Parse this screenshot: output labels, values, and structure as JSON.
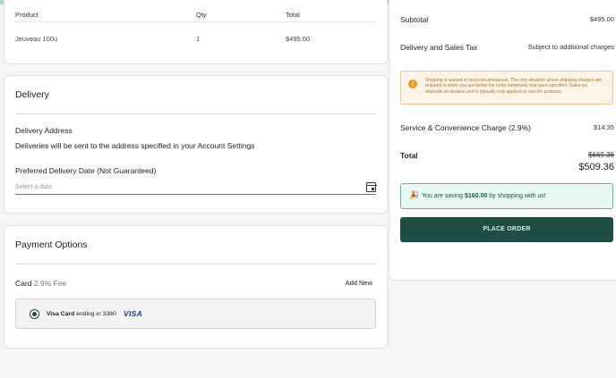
{
  "items": {
    "headers": {
      "product": "Product",
      "qty": "Qty",
      "total": "Total"
    },
    "rows": [
      {
        "product": "Jeuveau 100u",
        "qty": "1",
        "total": "$495.00"
      }
    ]
  },
  "delivery": {
    "title": "Delivery",
    "address_label": "Delivery Address",
    "address_text": "Deliveries will be sent to the address specified in your Account Settings",
    "date_label": "Preferred Delivery Date (Not Guaranteed)",
    "date_placeholder": "Select a date",
    "calendar_icon": "calendar-icon"
  },
  "payment": {
    "title": "Payment Options",
    "card_label": "Card",
    "card_fee": "2.9% Fee",
    "add_new": "Add New",
    "selected_card": {
      "name": "Visa Card",
      "ending": "ending in 3380",
      "brand": "VISA"
    }
  },
  "summary": {
    "subtotal_label": "Subtotal",
    "subtotal_value": "$495.00",
    "delivery_tax_label": "Delivery and Sales Tax",
    "delivery_tax_value": "Subject to additional charges",
    "notice": "Shipping is waived in most circumstances. The only situation where shipping charges are required is when you are below the order minimums that were specified. Sales tax depends on location and is typically only applied on non-Rx products.",
    "service_label": "Service & Convenience Charge (2.9%)",
    "service_value": "$14.35",
    "total_label": "Total",
    "total_original": "$669.36",
    "total_value": "$509.36",
    "savings_prefix": "You are saving",
    "savings_amount": "$160.00",
    "savings_suffix": "by shopping with us!",
    "place_order": "PLACE ORDER"
  },
  "colors": {
    "primary": "#1d4d44",
    "notice_bg": "#fdf4e7",
    "notice_border": "#efc98f",
    "savings_bg": "#e7f7f2",
    "savings_border": "#5bb8a2",
    "top_bar": "#a8d8d8"
  }
}
